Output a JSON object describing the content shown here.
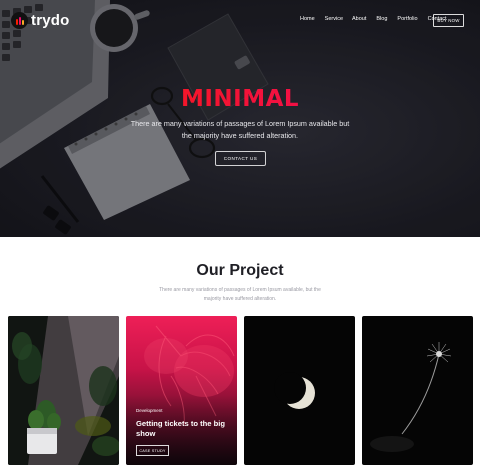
{
  "brand": {
    "name": "trydo",
    "logo_bar_colors": [
      "#f81f01",
      "#ee076e",
      "#f9a825"
    ]
  },
  "nav": {
    "items": [
      {
        "label": "Home"
      },
      {
        "label": "Service"
      },
      {
        "label": "About"
      },
      {
        "label": "Blog"
      },
      {
        "label": "Portfolio"
      },
      {
        "label": "Contact"
      }
    ],
    "buy_label": "BUY NOW"
  },
  "hero": {
    "title": "MINIMAL",
    "subtitle": "There are many variations of passages of Lorem Ipsum available but the majority have suffered alteration.",
    "cta_label": "CONTACT US",
    "gradient_colors": [
      "#f81f01",
      "#ee076e"
    ]
  },
  "projects": {
    "title": "Our Project",
    "subtitle": "There are many variations of passages of Lorem Ipsum available, but the majority have suffered alteration.",
    "cards": [
      {
        "image": "plant-photo"
      },
      {
        "image": "palm-leaf-photo",
        "category": "Development",
        "title": "Getting tickets to the big show",
        "button_label": "CASE STUDY"
      },
      {
        "image": "crescent-moon-photo"
      },
      {
        "image": "dandelion-photo"
      }
    ]
  }
}
